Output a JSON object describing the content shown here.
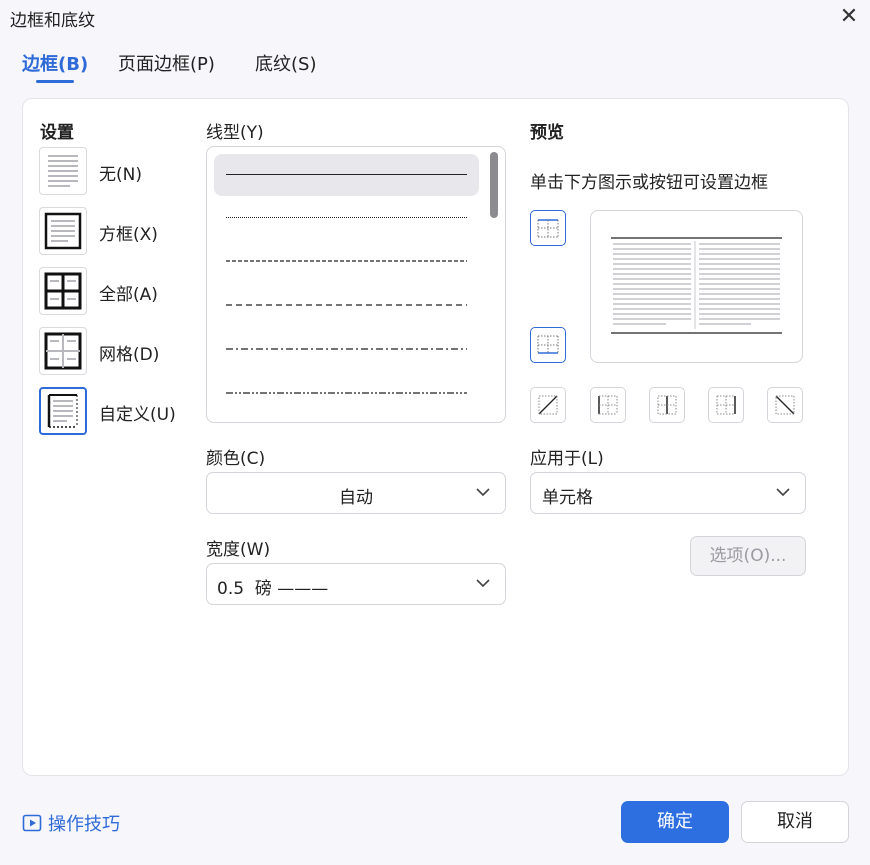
{
  "window": {
    "title": "边框和底纹",
    "close_glyph": "✕"
  },
  "tabs": [
    {
      "label": "边框(B)",
      "active": true
    },
    {
      "label": "页面边框(P)",
      "active": false
    },
    {
      "label": "底纹(S)",
      "active": false
    }
  ],
  "settings": {
    "heading": "设置",
    "items": [
      {
        "label": "无(N)",
        "icon": "no-border-icon"
      },
      {
        "label": "方框(X)",
        "icon": "box-border-icon"
      },
      {
        "label": "全部(A)",
        "icon": "all-borders-icon"
      },
      {
        "label": "网格(D)",
        "icon": "grid-border-icon"
      },
      {
        "label": "自定义(U)",
        "icon": "custom-border-icon",
        "selected": true
      }
    ]
  },
  "line_style": {
    "label": "线型(Y)",
    "options": [
      "solid",
      "dotted",
      "dashed-small",
      "dashed",
      "dash-dot",
      "dash-dot-dot"
    ],
    "selected_index": 0
  },
  "color": {
    "label": "颜色(C)",
    "value": "自动"
  },
  "width": {
    "label": "宽度(W)",
    "value": "0.5  磅 ———"
  },
  "preview": {
    "heading": "预览",
    "hint": "单击下方图示或按钮可设置边框"
  },
  "apply_to": {
    "label": "应用于(L)",
    "value": "单元格"
  },
  "options_button": "选项(O)...",
  "footer": {
    "tips": "操作技巧",
    "ok": "确定",
    "cancel": "取消"
  },
  "colors": {
    "accent": "#2f6bd8",
    "ok_button": "#2d6fe0"
  }
}
